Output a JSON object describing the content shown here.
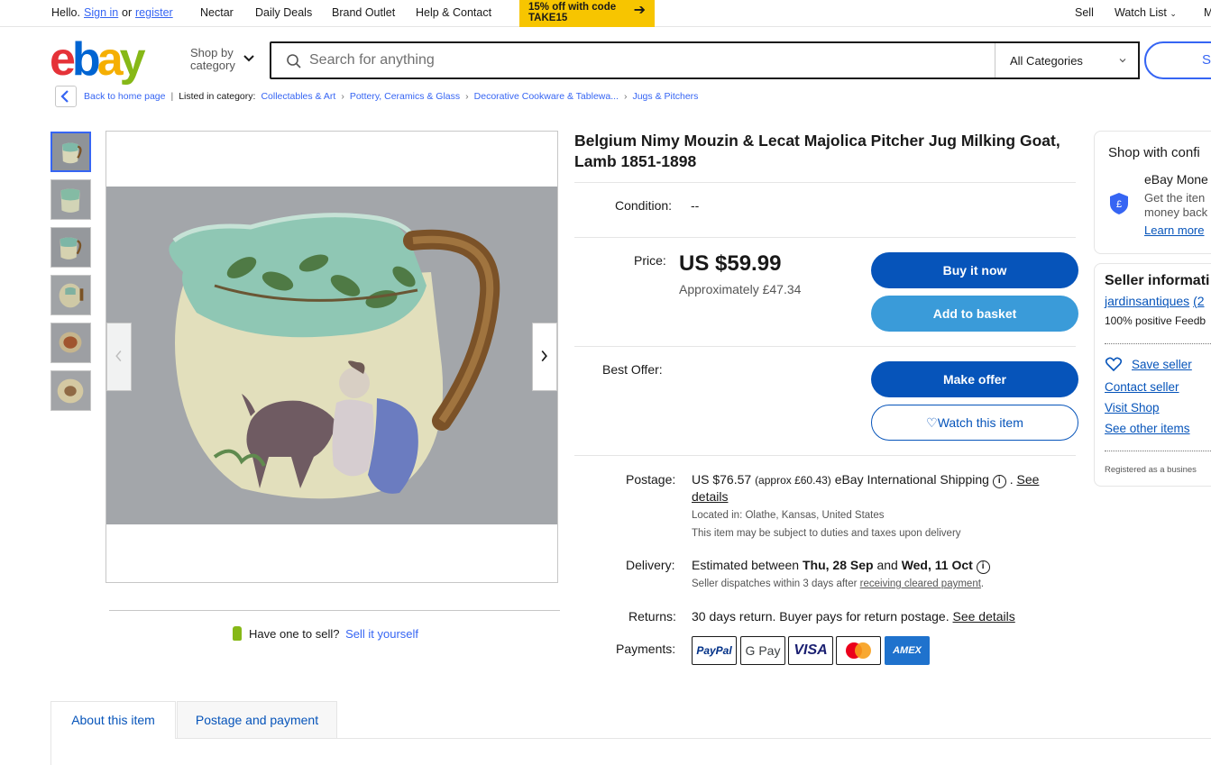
{
  "topbar": {
    "hello": "Hello.",
    "sign_in": "Sign in",
    "or": "or",
    "register": "register",
    "nectar": "Nectar",
    "daily_deals": "Daily Deals",
    "brand_outlet": "Brand Outlet",
    "help": "Help & Contact",
    "promo_line1": "15% off with code",
    "promo_line2": "TAKE15",
    "sell": "Sell",
    "watch_list": "Watch List",
    "my": "M"
  },
  "header": {
    "shop_by_line1": "Shop by",
    "shop_by_line2": "category",
    "search_placeholder": "Search for anything",
    "category_selected": "All Categories",
    "search_button": "Se"
  },
  "breadcrumb": {
    "back": "Back to home page",
    "listed_in": "Listed in category:",
    "items": [
      "Collectables & Art",
      "Pottery, Ceramics & Glass",
      "Decorative Cookware & Tablewa...",
      "Jugs & Pitchers"
    ]
  },
  "listing": {
    "title": "Belgium Nimy Mouzin & Lecat Majolica Pitcher Jug Milking Goat, Lamb 1851-1898",
    "condition_label": "Condition:",
    "condition_value": "--",
    "price_label": "Price:",
    "price": "US $59.99",
    "approx": "Approximately £47.34",
    "buy_now": "Buy it now",
    "add_to_basket": "Add to basket",
    "best_offer_label": "Best Offer:",
    "make_offer": "Make offer",
    "watch": "Watch this item",
    "postage_label": "Postage:",
    "postage_price": "US $76.57",
    "postage_approx": "(approx £60.43)",
    "postage_service": "eBay International Shipping",
    "see": "See",
    "details": "details",
    "located": "Located in: Olathe, Kansas, United States",
    "duties": "This item may be subject to duties and taxes upon delivery",
    "delivery_label": "Delivery:",
    "delivery_text": "Estimated between",
    "delivery_from": "Thu, 28 Sep",
    "delivery_and": "and",
    "delivery_to": "Wed, 11 Oct",
    "dispatch_text": "Seller dispatches within 3 days after",
    "dispatch_link": "receiving cleared payment",
    "returns_label": "Returns:",
    "returns_text": "30 days return. Buyer pays for return postage.",
    "returns_link": "See details",
    "payments_label": "Payments:",
    "payments": [
      "PayPal",
      "G Pay",
      "VISA",
      "Mastercard",
      "AMEX"
    ]
  },
  "gallery": {
    "have_one": "Have one to sell?",
    "sell_it": "Sell it yourself"
  },
  "confidence": {
    "heading": "Shop with confi",
    "mb_title": "eBay Mone",
    "mb_line1": "Get the iten",
    "mb_line2": "money back",
    "learn_more": "Learn more"
  },
  "seller": {
    "heading": "Seller informati",
    "name": "jardinsantiques",
    "count": "(2",
    "feedback": "100% positive Feedb",
    "save": "Save seller",
    "contact": "Contact seller",
    "visit": "Visit Shop",
    "other": "See other items",
    "registered": "Registered as a busines"
  },
  "tabs": {
    "about": "About this item",
    "postage": "Postage and payment"
  },
  "colors": {
    "ebay_red": "#e53238",
    "ebay_blue": "#0064d2",
    "ebay_yellow": "#f5af02",
    "ebay_green": "#86b817",
    "primary_button": "#0654ba",
    "secondary_button": "#3a9bd9",
    "promo": "#f7c500"
  }
}
